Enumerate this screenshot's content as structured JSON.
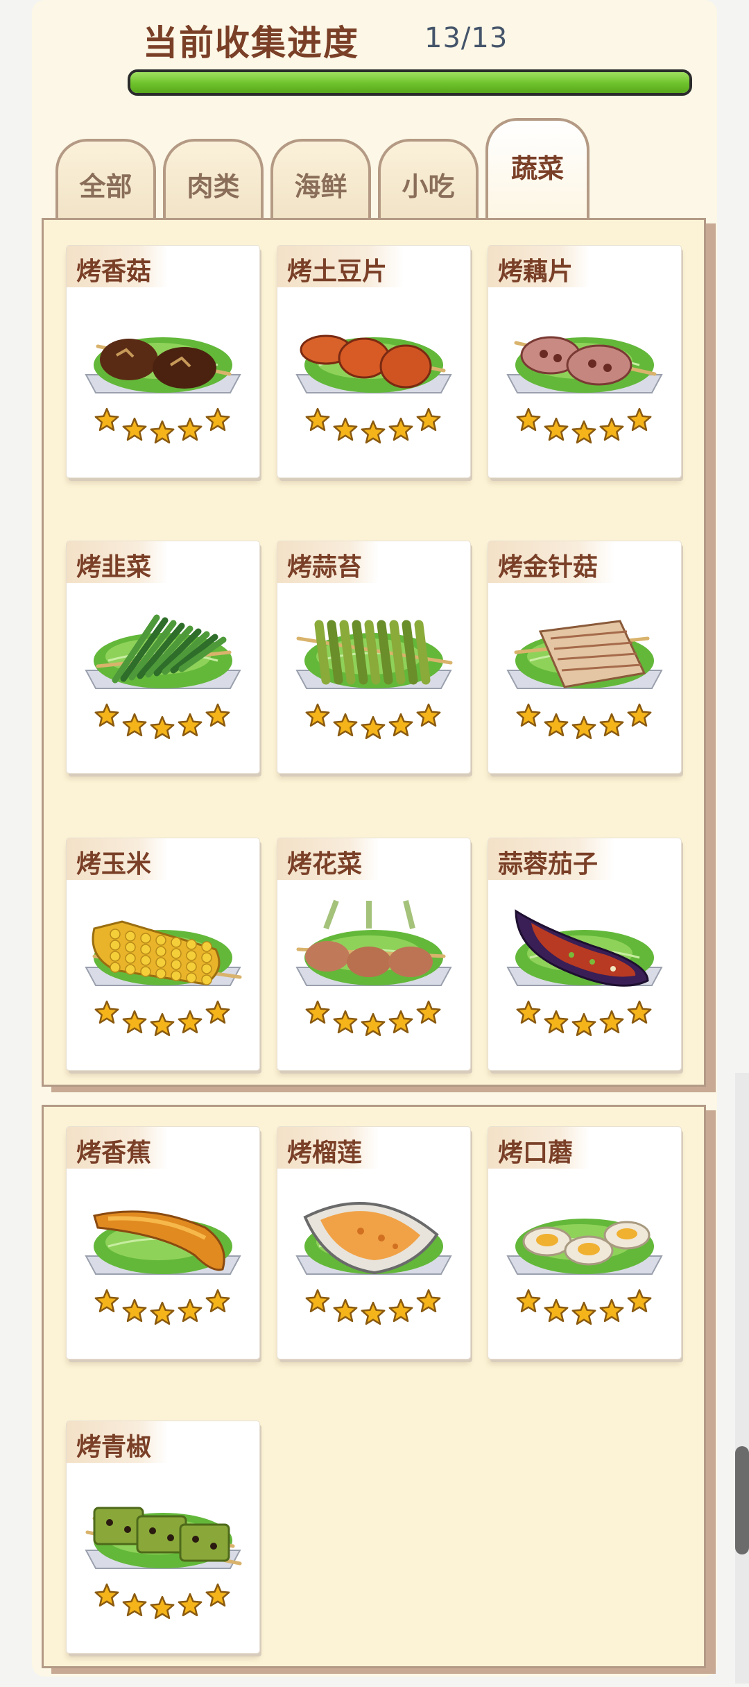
{
  "header": {
    "title": "当前收集进度",
    "count": "13/13",
    "progress": 1.0
  },
  "tabs": [
    {
      "label": "全部",
      "active": false
    },
    {
      "label": "肉类",
      "active": false
    },
    {
      "label": "海鲜",
      "active": false
    },
    {
      "label": "小吃",
      "active": false
    },
    {
      "label": "蔬菜",
      "active": true
    }
  ],
  "items": [
    {
      "name": "烤香菇",
      "food": "mushroom",
      "stars": 5
    },
    {
      "name": "烤土豆片",
      "food": "potato",
      "stars": 5
    },
    {
      "name": "烤藕片",
      "food": "lotus",
      "stars": 5
    },
    {
      "name": "烤韭菜",
      "food": "chives",
      "stars": 5
    },
    {
      "name": "烤蒜苔",
      "food": "garlic-shoot",
      "stars": 5
    },
    {
      "name": "烤金针菇",
      "food": "enoki",
      "stars": 5
    },
    {
      "name": "烤玉米",
      "food": "corn",
      "stars": 5
    },
    {
      "name": "烤花菜",
      "food": "cauliflower",
      "stars": 5
    },
    {
      "name": "蒜蓉茄子",
      "food": "eggplant",
      "stars": 5
    },
    {
      "name": "烤香蕉",
      "food": "banana",
      "stars": 5
    },
    {
      "name": "烤榴莲",
      "food": "durian",
      "stars": 5
    },
    {
      "name": "烤口蘑",
      "food": "button-mushroom",
      "stars": 5
    },
    {
      "name": "烤青椒",
      "food": "green-pepper",
      "stars": 5
    }
  ],
  "colors": {
    "accent": "#7a3f27",
    "progress_green": "#6ec22b",
    "star": "#f5b51a"
  }
}
